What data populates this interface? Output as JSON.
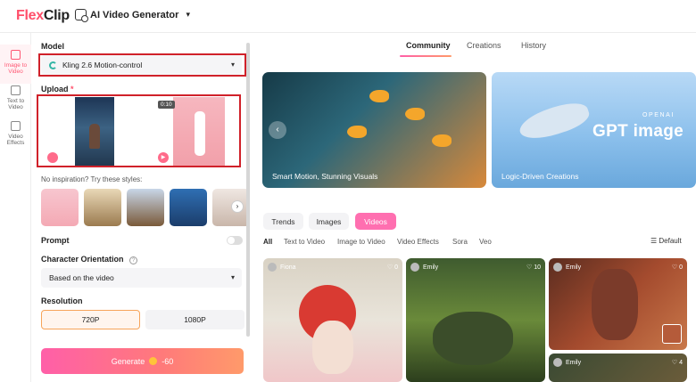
{
  "topbar": {
    "logo_part1": "Flex",
    "logo_part2": "Clip",
    "generator_label": "AI Video Generator"
  },
  "leftnav": {
    "items": [
      {
        "label_line1": "Image to",
        "label_line2": "Video",
        "active": true
      },
      {
        "label_line1": "Text to",
        "label_line2": "Video",
        "active": false
      },
      {
        "label_line1": "Video",
        "label_line2": "Effects",
        "active": false
      }
    ]
  },
  "panel": {
    "model_label": "Model",
    "model_value": "Kling 2.6 Motion-control",
    "upload_label": "Upload",
    "upload_required_mark": "*",
    "video_duration": "0:10",
    "hint": "No inspiration? Try these styles:",
    "prompt_label": "Prompt",
    "orientation_label": "Character Orientation",
    "orientation_value": "Based on the video",
    "resolution_label": "Resolution",
    "resolution_options": [
      "720P",
      "1080P"
    ],
    "resolution_selected": "720P",
    "generate_label": "Generate",
    "credits": "-60"
  },
  "main": {
    "tabs": [
      "Community",
      "Creations",
      "History"
    ],
    "active_tab": "Community",
    "banners": [
      {
        "caption": "Smart Motion, Stunning Visuals"
      },
      {
        "caption": "Logic-Driven Creations",
        "overlay_brand": "OPENAI",
        "overlay_title": "GPT image"
      }
    ],
    "chips": [
      "Trends",
      "Images",
      "Videos"
    ],
    "active_chip": "Videos",
    "filters": [
      "All",
      "Text to Video",
      "Image to Video",
      "Video Effects",
      "Sora",
      "Veo"
    ],
    "active_filter": "All",
    "sort_label": "Default",
    "cards": [
      {
        "user": "Fiona",
        "likes": "0"
      },
      {
        "user": "Emily",
        "likes": "10"
      },
      {
        "user": "Emily",
        "likes": "0"
      },
      {
        "user": "Emily",
        "likes": "4"
      }
    ]
  },
  "colors": {
    "accent_pink": "#ff5fa8",
    "highlight_box": "#d0212a",
    "selected_resolution_border": "#f7a45a"
  }
}
